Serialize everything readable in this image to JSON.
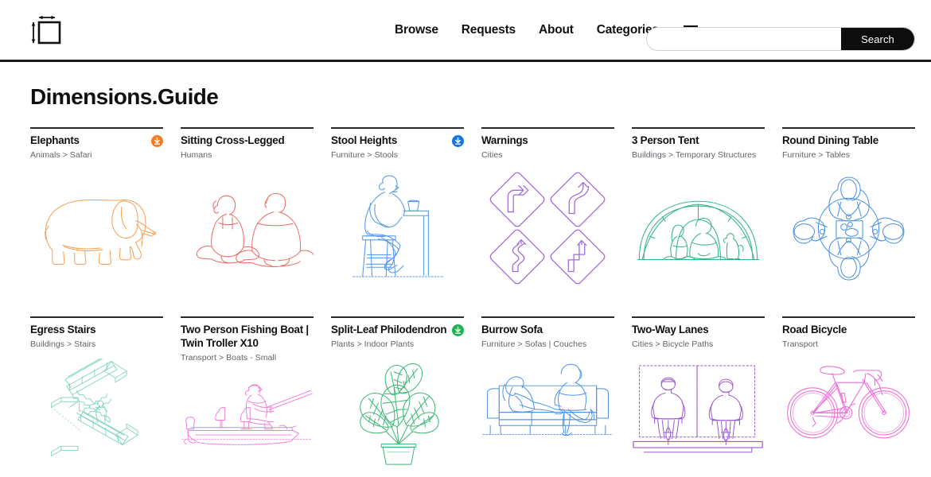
{
  "header": {
    "logo_name": "dimensions-guide-logo",
    "nav": [
      {
        "label": "Browse",
        "name": "nav-browse"
      },
      {
        "label": "Requests",
        "name": "nav-requests"
      },
      {
        "label": "About",
        "name": "nav-about"
      },
      {
        "label": "Categories",
        "name": "nav-categories"
      }
    ],
    "menu_icon": "hamburger-menu-icon",
    "search": {
      "value": "",
      "placeholder": "",
      "button_label": "Search"
    }
  },
  "page_title": "Dimensions.Guide",
  "colors": {
    "orange": "#F5A055",
    "blue": "#4A90E2",
    "green": "#27AE60",
    "accent_black": "#0d0d0d"
  },
  "cards": [
    {
      "title": "Elephants",
      "subtitle": "Animals > Safari",
      "download_icon": true,
      "download_color": "#F57C20",
      "art": "elephant",
      "art_color": "#F5A055"
    },
    {
      "title": "Sitting Cross-Legged",
      "subtitle": "Humans",
      "download_icon": false,
      "download_color": "",
      "art": "sitting-cross-legged",
      "art_color": "#ED6A63"
    },
    {
      "title": "Stool Heights",
      "subtitle": "Furniture > Stools",
      "download_icon": true,
      "download_color": "#1574E0",
      "art": "stool-heights",
      "art_color": "#5B9BE8"
    },
    {
      "title": "Warnings",
      "subtitle": "Cities",
      "download_icon": false,
      "download_color": "",
      "art": "warning-signs",
      "art_color": "#A16BD8"
    },
    {
      "title": "3 Person Tent",
      "subtitle": "Buildings > Temporary Structures",
      "download_icon": false,
      "download_color": "",
      "art": "tent",
      "art_color": "#35B58E"
    },
    {
      "title": "Round Dining Table",
      "subtitle": "Furniture > Tables",
      "download_icon": false,
      "download_color": "",
      "art": "round-dining-table",
      "art_color": "#4A90E2"
    },
    {
      "title": "Egress Stairs",
      "subtitle": "Buildings > Stairs",
      "download_icon": false,
      "download_color": "",
      "art": "egress-stairs",
      "art_color": "#7FD3BE"
    },
    {
      "title": "Two Person Fishing Boat | Twin Troller X10",
      "subtitle": "Transport > Boats - Small",
      "download_icon": false,
      "download_color": "",
      "art": "fishing-boat",
      "art_color": "#F07FDA"
    },
    {
      "title": "Split-Leaf Philodendron",
      "subtitle": "Plants > Indoor Plants",
      "download_icon": true,
      "download_color": "#22B24C",
      "art": "philodendron",
      "art_color": "#3FB977"
    },
    {
      "title": "Burrow Sofa",
      "subtitle": "Furniture > Sofas | Couches",
      "download_icon": false,
      "download_color": "",
      "art": "sofa",
      "art_color": "#4A90E2"
    },
    {
      "title": "Two-Way Lanes",
      "subtitle": "Cities > Bicycle Paths",
      "download_icon": false,
      "download_color": "",
      "art": "two-way-lanes",
      "art_color": "#9B59D0"
    },
    {
      "title": "Road Bicycle",
      "subtitle": "Transport",
      "download_icon": false,
      "download_color": "",
      "art": "road-bicycle",
      "art_color": "#EE6FD8"
    }
  ]
}
